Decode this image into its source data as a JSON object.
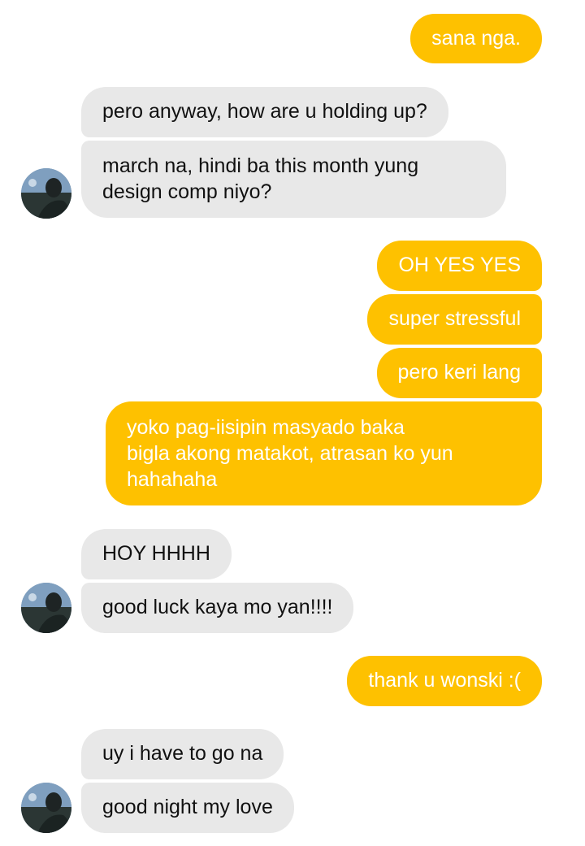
{
  "conversation": {
    "messages": [
      {
        "side": "out",
        "text": "sana nga."
      },
      {
        "side": "in",
        "text": "pero anyway, how are u holding up?"
      },
      {
        "side": "in",
        "text": "march na, hindi ba this month yung\ndesign comp niyo?"
      },
      {
        "side": "out",
        "text": "OH YES YES"
      },
      {
        "side": "out",
        "text": "super stressful"
      },
      {
        "side": "out",
        "text": "pero keri lang"
      },
      {
        "side": "out",
        "text": "yoko pag-iisipin masyado baka\nbigla akong matakot, atrasan ko yun\nhahahaha"
      },
      {
        "side": "in",
        "text": "HOY HHHH"
      },
      {
        "side": "in",
        "text": "good luck kaya mo yan!!!!"
      },
      {
        "side": "out",
        "text": "thank u wonski :("
      },
      {
        "side": "in",
        "text": "uy i have to go na"
      },
      {
        "side": "in",
        "text": "good night my love"
      }
    ],
    "colors": {
      "outgoing_bubble": "#fec100",
      "outgoing_text": "#ffffff",
      "incoming_bubble": "#e8e8e8",
      "incoming_text": "#111111"
    },
    "contact_avatar": "contact-avatar-photo"
  }
}
